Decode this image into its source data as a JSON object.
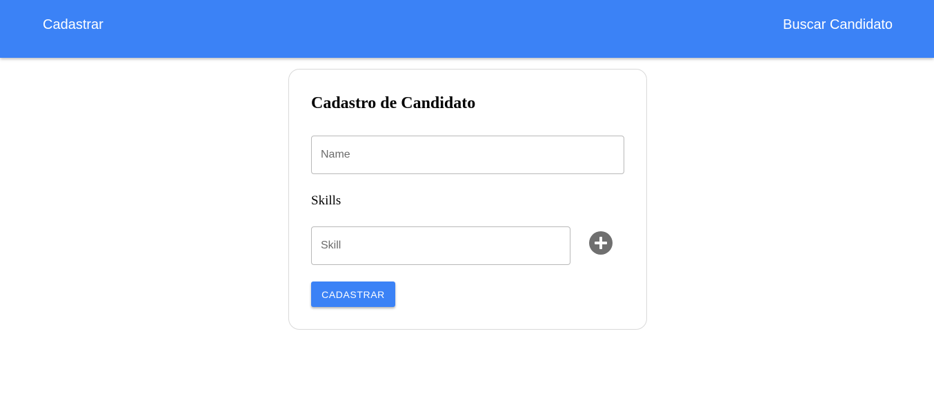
{
  "header": {
    "nav_left": "Cadastrar",
    "nav_right": "Buscar Candidato",
    "background_color": "#3b82f6"
  },
  "form": {
    "title": "Cadastro de Candidato",
    "name_placeholder": "Name",
    "name_value": "",
    "skills_label": "Skills",
    "skill_placeholder": "Skill",
    "skill_value": "",
    "add_icon": "plus-circle-icon",
    "submit_label": "CADASTRAR"
  },
  "colors": {
    "accent": "#3b82f6",
    "icon_gray": "#6f6f6f"
  }
}
